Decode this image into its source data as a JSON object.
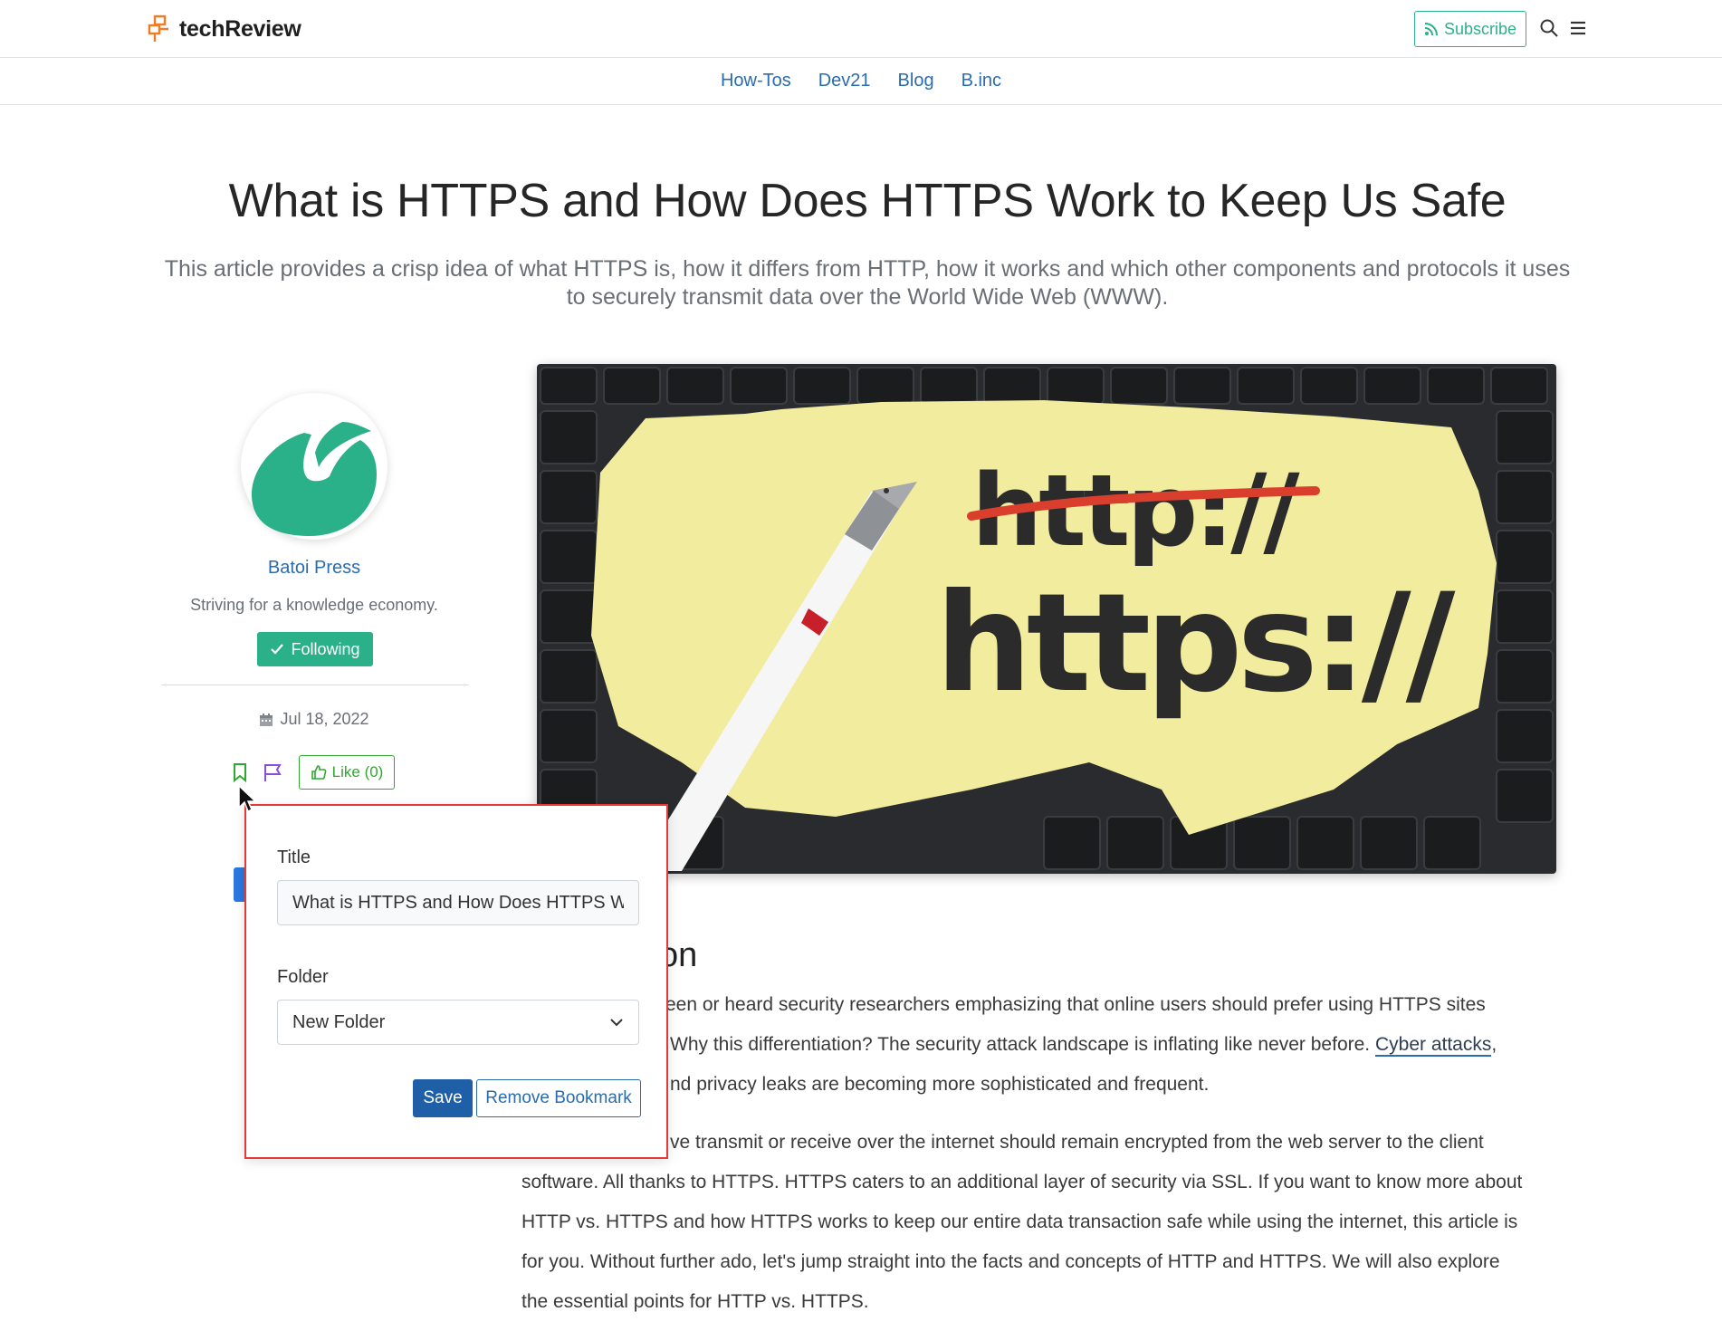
{
  "header": {
    "brand": "techReview",
    "subscribe_label": "Subscribe",
    "brand_color": "#f47b20",
    "accent_color": "#2bb18a"
  },
  "nav": {
    "items": [
      "How-Tos",
      "Dev21",
      "Blog",
      "B.inc"
    ]
  },
  "article": {
    "title": "What is HTTPS and How Does HTTPS Work to Keep Us Safe",
    "subtitle": "This article provides a crisp idea of what HTTPS is, how it differs from HTTP, how it works and which other components and protocols it uses to securely transmit data over the World Wide Web (WWW).",
    "section_heading_fragment": "on",
    "para1": [
      "een or heard security researchers emphasizing that online users should prefer using HTTPS sites",
      "Why this differentiation? The security attack landscape is inflating like never before.",
      "Cyber attacks",
      ",",
      "nd privacy leaks are becoming more sophisticated and frequent."
    ],
    "para2": [
      "ve transmit or receive over the internet should remain encrypted from the web server to the client",
      "software. All thanks to HTTPS. HTTPS caters to an additional layer of security via SSL. If you want to know more about",
      "HTTP vs. HTTPS and how HTTPS works to keep our entire data transaction safe while using the internet, this article is",
      "for you. Without further ado, let's jump straight into the facts and concepts of HTTP and HTTPS. We will also explore",
      "the essential points for HTTP vs. HTTPS."
    ]
  },
  "hero": {
    "strike_text": "http://",
    "main_text": "https://"
  },
  "author": {
    "name": "Batoi Press",
    "tagline": "Striving for a knowledge economy.",
    "follow_label": "Following",
    "date": "Jul 18, 2022",
    "like_label": "Like (0)"
  },
  "bookmark_popover": {
    "title_label": "Title",
    "title_value": "What is HTTPS and How Does HTTPS Work to Keep Us Safe",
    "folder_label": "Folder",
    "folder_value": "New Folder",
    "save_label": "Save",
    "remove_label": "Remove Bookmark"
  }
}
